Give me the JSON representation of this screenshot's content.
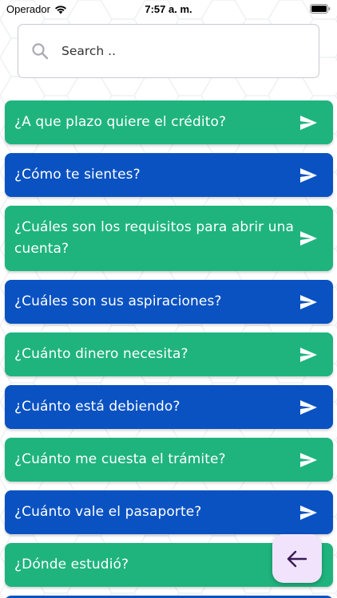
{
  "status": {
    "carrier": "Operador",
    "time": "7:57 a. m."
  },
  "search": {
    "placeholder": "Search .."
  },
  "colors": {
    "green": "#1fb47e",
    "blue": "#0a52c2",
    "fab_bg": "#f0e3fb",
    "fab_icon": "#3a1a55"
  },
  "questions": [
    {
      "text": "¿A que plazo quiere el crédito?",
      "color": "green"
    },
    {
      "text": "¿Cómo te sientes?",
      "color": "blue"
    },
    {
      "text": "¿Cuáles son los requisitos para abrir una cuenta?",
      "color": "green"
    },
    {
      "text": "¿Cuáles son sus aspiraciones?",
      "color": "blue"
    },
    {
      "text": "¿Cuánto dinero necesita?",
      "color": "green"
    },
    {
      "text": "¿Cuánto está debiendo?",
      "color": "blue"
    },
    {
      "text": "¿Cuánto me cuesta el trámite?",
      "color": "green"
    },
    {
      "text": "¿Cuánto vale el pasaporte?",
      "color": "blue"
    },
    {
      "text": "¿Dónde estudió?",
      "color": "green"
    }
  ],
  "icons": {
    "send": "send-icon",
    "back": "arrow-left-icon",
    "search": "search-icon",
    "wifi": "wifi-icon",
    "battery": "battery-icon"
  }
}
